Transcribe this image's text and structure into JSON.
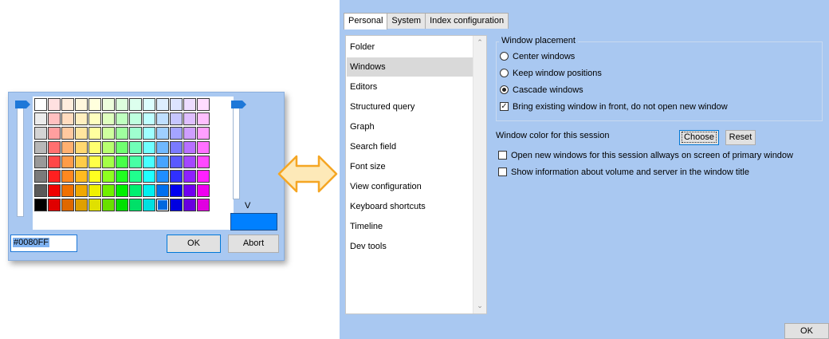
{
  "color_picker": {
    "hex_value": "#0080FF",
    "v_label": "V",
    "ok_label": "OK",
    "abort_label": "Abort",
    "preview_color": "#0080FF",
    "palette_rows": [
      [
        "#ffffff",
        "#ffe0e0",
        "#ffeedd",
        "#fff7dd",
        "#ffffdd",
        "#eeffdd",
        "#ddffdd",
        "#ddffee",
        "#ddffff",
        "#ddeeff",
        "#dde4ff",
        "#eeddff",
        "#ffddff"
      ],
      [
        "#ececec",
        "#ffc0c0",
        "#ffdcbf",
        "#ffefbf",
        "#ffffbf",
        "#dfffbf",
        "#bfffbf",
        "#bfffdf",
        "#bfffff",
        "#bfdfff",
        "#c6c6ff",
        "#dfbfff",
        "#ffbfff"
      ],
      [
        "#d4d4d4",
        "#ff9f9f",
        "#ffc99f",
        "#ffe59f",
        "#ffff9f",
        "#cfff9f",
        "#9fff9f",
        "#9fffcf",
        "#9fffff",
        "#9fcfff",
        "#a4a4ff",
        "#cf9fff",
        "#ff9fff"
      ],
      [
        "#b8b8b8",
        "#ff7070",
        "#ffb070",
        "#ffd870",
        "#ffff70",
        "#b8ff70",
        "#70ff70",
        "#70ffb8",
        "#70ffff",
        "#70b8ff",
        "#7a7aff",
        "#b870ff",
        "#ff70ff"
      ],
      [
        "#999999",
        "#ff4848",
        "#ff9c48",
        "#ffcc48",
        "#ffff48",
        "#a4ff48",
        "#48ff48",
        "#48ffa4",
        "#48ffff",
        "#48a4ff",
        "#5a5aff",
        "#a448ff",
        "#ff48ff"
      ],
      [
        "#7a7a7a",
        "#ff2020",
        "#ff8820",
        "#ffbb20",
        "#ffff20",
        "#8eff20",
        "#20ff20",
        "#20ff8e",
        "#20ffff",
        "#208eff",
        "#3030ff",
        "#8e20ff",
        "#ff20ff"
      ],
      [
        "#5a5a5a",
        "#f00000",
        "#f07000",
        "#f0a800",
        "#f0f000",
        "#70f000",
        "#00f000",
        "#00f070",
        "#00f0f0",
        "#0070f0",
        "#0000f0",
        "#7000f0",
        "#f000f0"
      ],
      [
        "#000000",
        "#e00000",
        "#e06800",
        "#e0a000",
        "#e0e000",
        "#68e000",
        "#00e000",
        "#00e068",
        "#00e0e0",
        "#0068e0",
        "#0000e0",
        "#6800e0",
        "#e000e0"
      ]
    ],
    "selected_cell": [
      7,
      9
    ]
  },
  "settings": {
    "tabs": [
      "Personal",
      "System",
      "Index configuration"
    ],
    "active_tab": 0,
    "list_items": [
      "Folder",
      "Windows",
      "Editors",
      "Structured query",
      "Graph",
      "Search field",
      "Font size",
      "View configuration",
      "Keyboard shortcuts",
      "Timeline",
      "Dev tools"
    ],
    "selected_item": 1,
    "placement_title": "Window placement",
    "radio_center": "Center windows",
    "radio_keep": "Keep window positions",
    "radio_cascade": "Cascade windows",
    "check_bring": "Bring existing window in front, do not open new window",
    "window_color_label": "Window color for this session",
    "choose_label": "Choose",
    "reset_label": "Reset",
    "check_primary": "Open new windows for this session allways on screen of primary window",
    "check_volume": "Show information about volume and server in the window title",
    "ok_label": "OK"
  },
  "colors": {
    "dialog_bg": "#A9C8F1",
    "accent": "#0080FF",
    "arrow": "#F5A623"
  }
}
